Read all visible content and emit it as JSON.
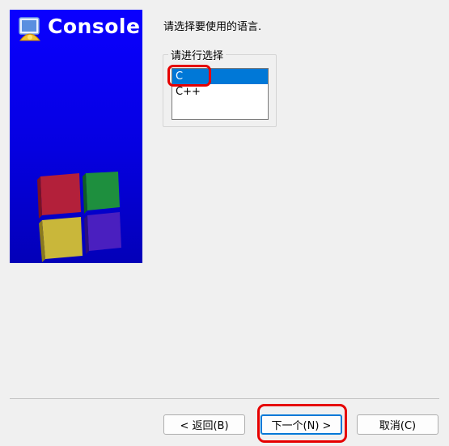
{
  "sidebar": {
    "title": "Console",
    "cube_colors": [
      "#b3203a",
      "#1e8f3e",
      "#c9b73a",
      "#4a1fbf"
    ],
    "background": "#0a00ff"
  },
  "main": {
    "prompt": "请选择要使用的语言.",
    "group_label": "请进行选择",
    "options": [
      {
        "label": "C",
        "selected": true
      },
      {
        "label": "C++",
        "selected": false
      }
    ]
  },
  "footer": {
    "back_label": "< 返回(B)",
    "next_label": "下一个(N) >",
    "cancel_label": "取消(C)"
  },
  "annotation_color": "#e60000"
}
